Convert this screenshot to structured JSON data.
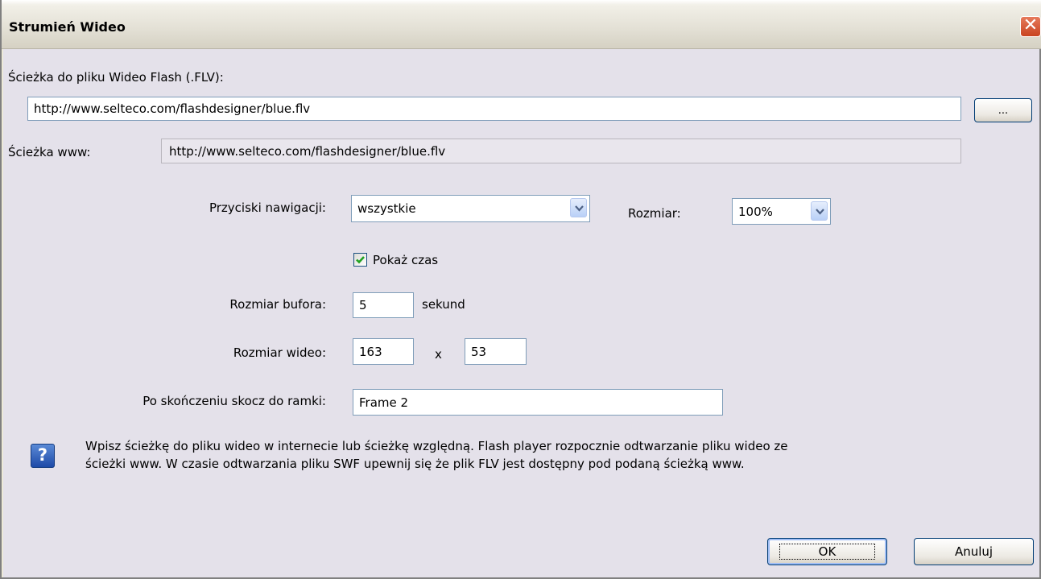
{
  "window": {
    "title": "Strumień Wideo",
    "close_icon": "close-icon"
  },
  "path": {
    "label": "Ścieżka do pliku Wideo Flash (.FLV):",
    "value": "http://www.selteco.com/flashdesigner/blue.flv",
    "browse_label": "..."
  },
  "www": {
    "label": "Ścieżka www:",
    "value": "http://www.selteco.com/flashdesigner/blue.flv"
  },
  "navigation": {
    "label": "Przyciski nawigacji:",
    "selected": "wszystkie"
  },
  "size": {
    "label": "Rozmiar:",
    "selected": "100%"
  },
  "show_time": {
    "label": "Pokaż czas",
    "checked": true
  },
  "buffer": {
    "label": "Rozmiar bufora:",
    "value": "5",
    "unit": "sekund"
  },
  "video_size": {
    "label": "Rozmiar wideo:",
    "width": "163",
    "separator": "x",
    "height": "53"
  },
  "end_frame": {
    "label": "Po skończeniu skocz do ramki:",
    "value": "Frame 2"
  },
  "help": {
    "icon": "help-icon",
    "icon_glyph": "?",
    "line1": "Wpisz ścieżkę do pliku wideo w internecie lub ścieżkę względną. Flash player rozpocznie odtwarzanie pliku wideo ze",
    "line2": "ścieżki www. W czasie odtwarzania pliku SWF upewnij się że plik FLV jest dostępny pod podaną ścieżką www."
  },
  "buttons": {
    "ok": "OK",
    "cancel": "Anuluj"
  },
  "colors": {
    "content_bg": "#e4e1ea",
    "titlebar_bg": "#ece9d8",
    "close_red": "#d4542f"
  }
}
